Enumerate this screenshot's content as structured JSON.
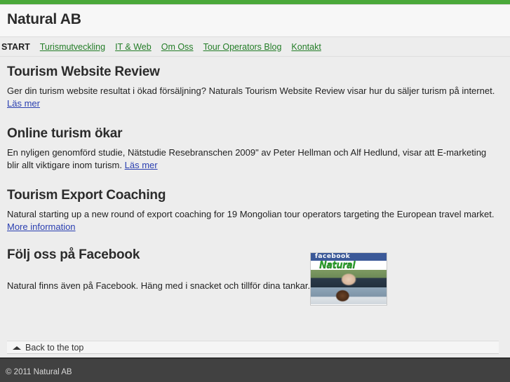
{
  "theme": {
    "accent_green": "#4aa83a",
    "nav_link_green": "#237d27",
    "inline_link_blue": "#2a3fb0",
    "content_bg": "#ededed",
    "header_bg": "#f7f7f7",
    "footer_bg": "#414141",
    "facebook_blue": "#3b5998"
  },
  "header": {
    "site_title": "Natural AB"
  },
  "nav": {
    "items": [
      {
        "label": "START",
        "current": true
      },
      {
        "label": "Turismutveckling",
        "current": false
      },
      {
        "label": "IT & Web",
        "current": false
      },
      {
        "label": "Om Oss",
        "current": false
      },
      {
        "label": "Tour Operators Blog",
        "current": false
      },
      {
        "label": "Kontakt",
        "current": false
      }
    ]
  },
  "posts": [
    {
      "title": "Tourism Website Review",
      "body": "Ger din turism website resultat i ökad försäljning? Naturals Tourism Website Review visar hur du säljer turism på internet.",
      "link_label": "Läs mer"
    },
    {
      "title": "Online turism ökar",
      "body": "En nyligen genomförd studie, Nätstudie Resebranschen 2009\" av Peter Hellman och Alf Hedlund, visar att E-marketing blir allt viktigare inom turism.",
      "link_label": "Läs mer"
    },
    {
      "title": "Tourism Export Coaching",
      "body": "Natural starting up a new round of export coaching for 19 Mongolian tour operators targeting the European travel market.",
      "link_label": "More information"
    }
  ],
  "facebook_section": {
    "title": "Följ oss på Facebook",
    "caption": "Natural finns även på Facebook. Häng med i snacket och tillför dina tankar.",
    "widget": {
      "wordmark": "facebook",
      "page_logo_text": "Natural"
    }
  },
  "back_to_top": {
    "label": "Back to the top",
    "icon": "triangle-up-icon"
  },
  "footer": {
    "copyright": "© 2011 Natural AB"
  }
}
